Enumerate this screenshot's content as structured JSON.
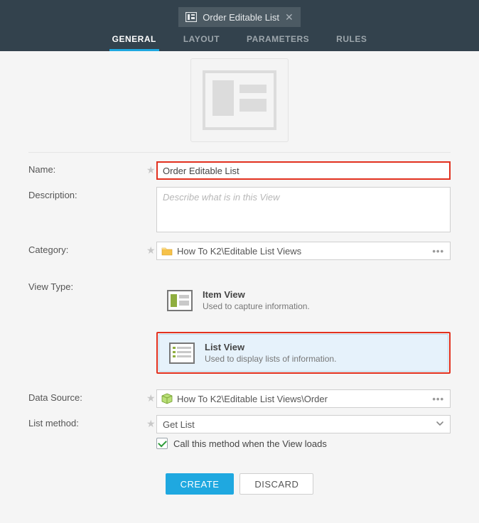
{
  "header": {
    "doc_title": "Order Editable List",
    "subtabs": [
      "GENERAL",
      "LAYOUT",
      "PARAMETERS",
      "RULES"
    ],
    "active_subtab": "GENERAL"
  },
  "form": {
    "name_label": "Name:",
    "name_value": "Order Editable List",
    "description_label": "Description:",
    "description_placeholder": "Describe what is in this View",
    "description_value": "",
    "category_label": "Category:",
    "category_value": "How To K2\\Editable List Views",
    "viewtype_label": "View Type:",
    "viewtypes": [
      {
        "title": "Item View",
        "subtitle": "Used to capture information.",
        "selected": false
      },
      {
        "title": "List View",
        "subtitle": "Used to display lists of information.",
        "selected": true
      }
    ],
    "datasource_label": "Data Source:",
    "datasource_value": "How To K2\\Editable List Views\\Order",
    "listmethod_label": "List method:",
    "listmethod_value": "Get List",
    "call_on_load_label": "Call this method when the View loads",
    "call_on_load_checked": true
  },
  "actions": {
    "create": "CREATE",
    "discard": "DISCARD"
  }
}
